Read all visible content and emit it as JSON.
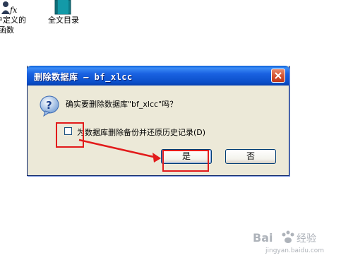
{
  "desktop": {
    "icons": [
      {
        "label_line1": "户定义的",
        "label_line2": "函数"
      },
      {
        "label_line1": "全文目录"
      }
    ]
  },
  "dialog": {
    "title": "删除数据库 — bf_xlcc",
    "message": "确实要删除数据库\"bf_xlcc\"吗？",
    "checkbox_label": "为数据库删除备份并还原历史记录(D)",
    "checkbox_checked": false,
    "yes_label": "是",
    "no_label": "否"
  },
  "annotation": {
    "color": "#e21b1b"
  },
  "watermark": {
    "text": "Bai 经验",
    "url": "jingyan.baidu.com"
  }
}
